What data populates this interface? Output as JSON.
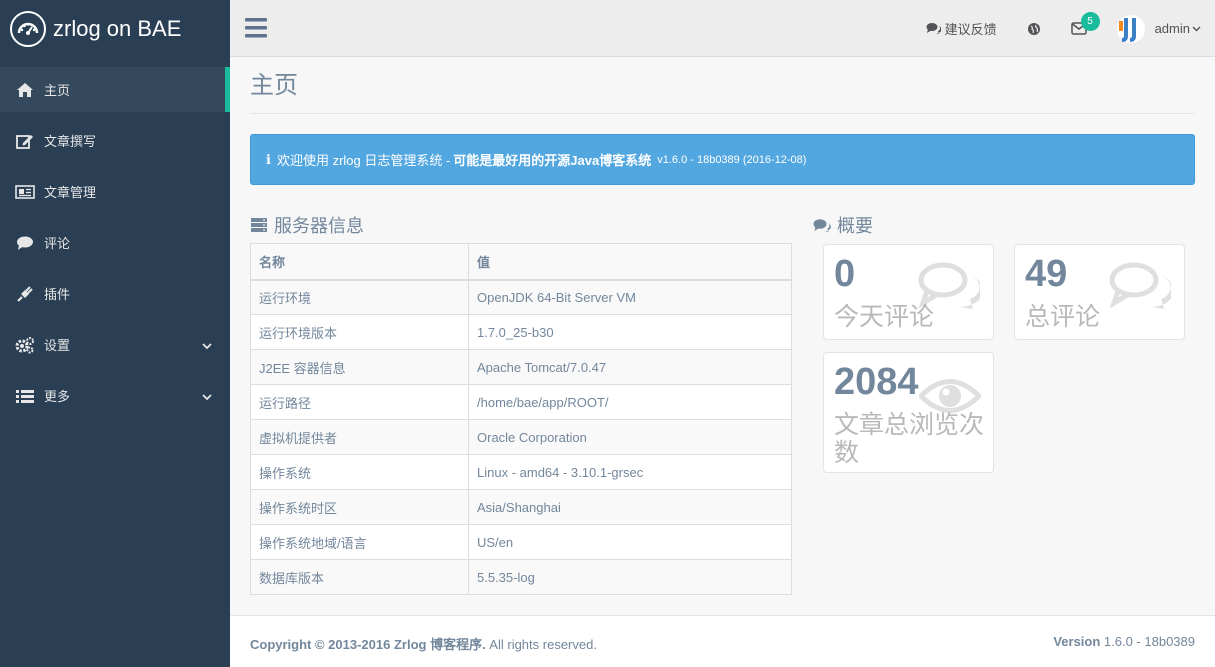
{
  "brand": {
    "title": "zrlog on BAE"
  },
  "sidebar": {
    "items": [
      {
        "label": "主页",
        "icon": "home-icon"
      },
      {
        "label": "文章撰写",
        "icon": "edit-icon"
      },
      {
        "label": "文章管理",
        "icon": "newspaper-icon"
      },
      {
        "label": "评论",
        "icon": "comment-icon"
      },
      {
        "label": "插件",
        "icon": "plug-icon"
      },
      {
        "label": "设置",
        "icon": "cogs-icon"
      },
      {
        "label": "更多",
        "icon": "list-icon"
      }
    ]
  },
  "topbar": {
    "feedback_label": "建议反馈",
    "mail_badge": "5",
    "user_label": "admin"
  },
  "page": {
    "title": "主页"
  },
  "alert": {
    "text_prefix": "欢迎使用 zrlog 日志管理系统 - ",
    "text_bold": "可能是最好用的开源Java博客系统",
    "version": "v1.6.0 - 18b0389 (2016-12-08)"
  },
  "server": {
    "title": "服务器信息",
    "headers": [
      "名称",
      "值"
    ],
    "rows": [
      [
        "运行环境",
        "OpenJDK 64-Bit Server VM"
      ],
      [
        "运行环境版本",
        "1.7.0_25-b30"
      ],
      [
        "J2EE 容器信息",
        "Apache Tomcat/7.0.47"
      ],
      [
        "运行路径",
        "/home/bae/app/ROOT/"
      ],
      [
        "虚拟机提供者",
        "Oracle Corporation"
      ],
      [
        "操作系统",
        "Linux - amd64 - 3.10.1-grsec"
      ],
      [
        "操作系统时区",
        "Asia/Shanghai"
      ],
      [
        "操作系统地域/语言",
        "US/en"
      ],
      [
        "数据库版本",
        "5.5.35-log"
      ]
    ]
  },
  "overview": {
    "title": "概要",
    "today_comments": {
      "value": "0",
      "label": "今天评论"
    },
    "total_comments": {
      "value": "49",
      "label": "总评论"
    },
    "total_views": {
      "value": "2084",
      "label": "文章总浏览次数"
    }
  },
  "footer": {
    "copyright_bold": "Copyright © 2013-2016 Zrlog 博客程序.",
    "copyright_rest": " All rights reserved.",
    "version_label": "Version",
    "version_value": " 1.6.0 - 18b0389"
  },
  "colors": {
    "sidebar": "#2a3f54",
    "accent": "#1abb9c",
    "alert": "#52a7e0"
  }
}
